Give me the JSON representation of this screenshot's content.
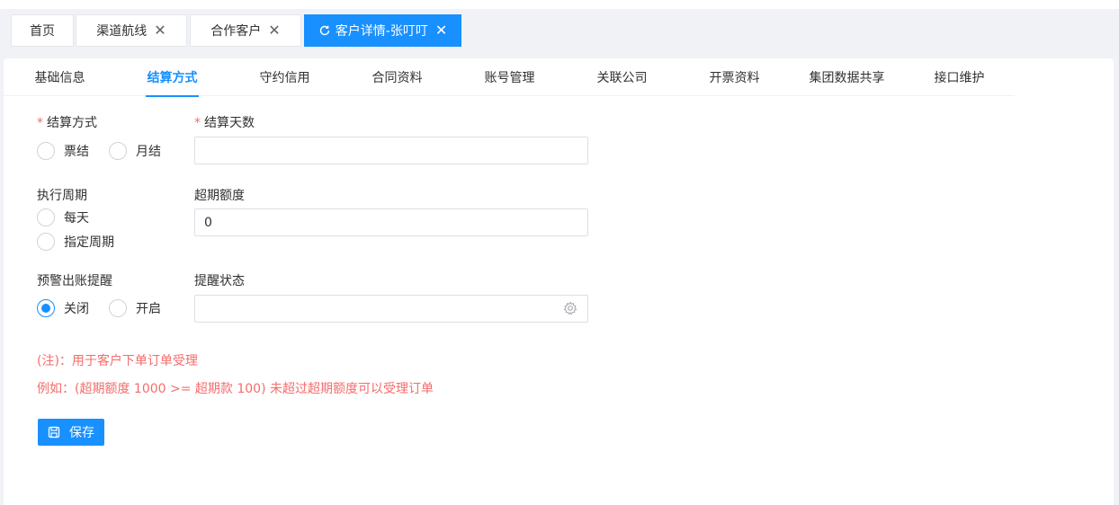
{
  "tabs": [
    {
      "label": "首页"
    },
    {
      "label": "渠道航线"
    },
    {
      "label": "合作客户"
    },
    {
      "label": "客户详情-张叮叮"
    }
  ],
  "subtabs": [
    {
      "label": "基础信息"
    },
    {
      "label": "结算方式"
    },
    {
      "label": "守约信用"
    },
    {
      "label": "合同资料"
    },
    {
      "label": "账号管理"
    },
    {
      "label": "关联公司"
    },
    {
      "label": "开票资料"
    },
    {
      "label": "集团数据共享"
    },
    {
      "label": "接口维护"
    }
  ],
  "form": {
    "settle_method": {
      "required_mark": "*",
      "label": "结算方式",
      "options": [
        "票结",
        "月结"
      ]
    },
    "settle_days": {
      "required_mark": "*",
      "label": "结算天数",
      "value": ""
    },
    "exec_period": {
      "label": "执行周期",
      "options": [
        "每天",
        "指定周期"
      ]
    },
    "overdue_amount": {
      "label": "超期额度",
      "value": "0"
    },
    "warning": {
      "label": "预警出账提醒",
      "options": [
        "关闭",
        "开启"
      ],
      "selected": "关闭"
    },
    "reminder_status": {
      "label": "提醒状态",
      "value": ""
    }
  },
  "notes": {
    "line1": "(注)：用于客户下单订单受理",
    "line2": "例如：(超期额度 1000 >= 超期款 100) 未超过超期额度可以受理订单"
  },
  "save_label": "保存",
  "colors": {
    "accent": "#1890ff",
    "required": "#f56c6c",
    "note": "#f56c6c"
  },
  "icons": {
    "tab_close": "close-icon",
    "tab_refresh": "refresh-icon",
    "select": "gear-icon",
    "save": "save-icon"
  }
}
